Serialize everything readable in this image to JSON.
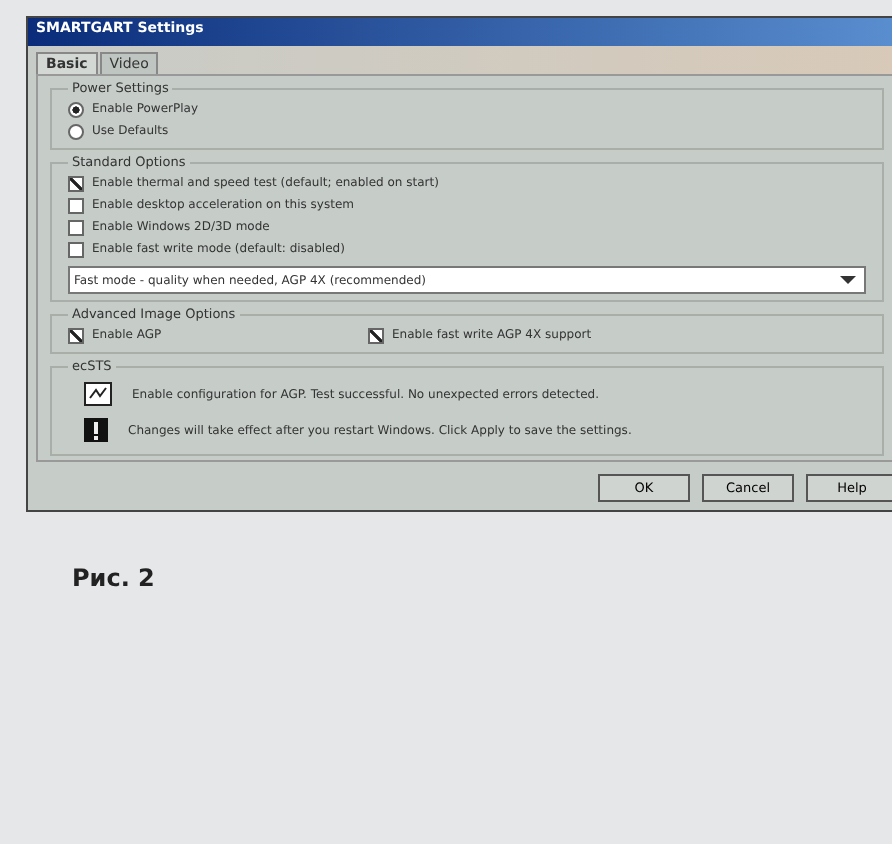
{
  "window": {
    "title": "SMARTGART Settings"
  },
  "tabs": [
    {
      "label": "Basic",
      "selected": true
    },
    {
      "label": "Video",
      "selected": false
    }
  ],
  "power_group": {
    "title": "Power Settings",
    "options": [
      {
        "label": "Enable PowerPlay",
        "selected": true
      },
      {
        "label": "Use Defaults",
        "selected": false
      }
    ]
  },
  "standard_group": {
    "title": "Standard Options",
    "options": [
      {
        "label": "Enable thermal and speed test (default; enabled on start)",
        "checked": true
      },
      {
        "label": "Enable desktop acceleration on this system",
        "checked": false
      },
      {
        "label": "Enable Windows 2D/3D mode",
        "checked": false
      },
      {
        "label": "Enable fast write mode (default: disabled)",
        "checked": false
      }
    ],
    "dropdown": {
      "value": "Fast mode - quality when needed, AGP 4X (recommended)"
    }
  },
  "advanced_group": {
    "title": "Advanced Image Options",
    "options": [
      {
        "label": "Enable AGP",
        "checked": true
      },
      {
        "label": "Enable fast write AGP 4X support",
        "checked": true
      }
    ]
  },
  "status_group": {
    "title": "ecSTS",
    "messages": [
      {
        "kind": "info",
        "text": "Enable configuration for AGP. Test successful. No unexpected errors detected."
      },
      {
        "kind": "warning",
        "text": "Changes will take effect after you restart Windows. Click Apply to save the settings."
      }
    ]
  },
  "buttons": [
    "OK",
    "Cancel",
    "Help"
  ],
  "caption": "Рис. 2"
}
